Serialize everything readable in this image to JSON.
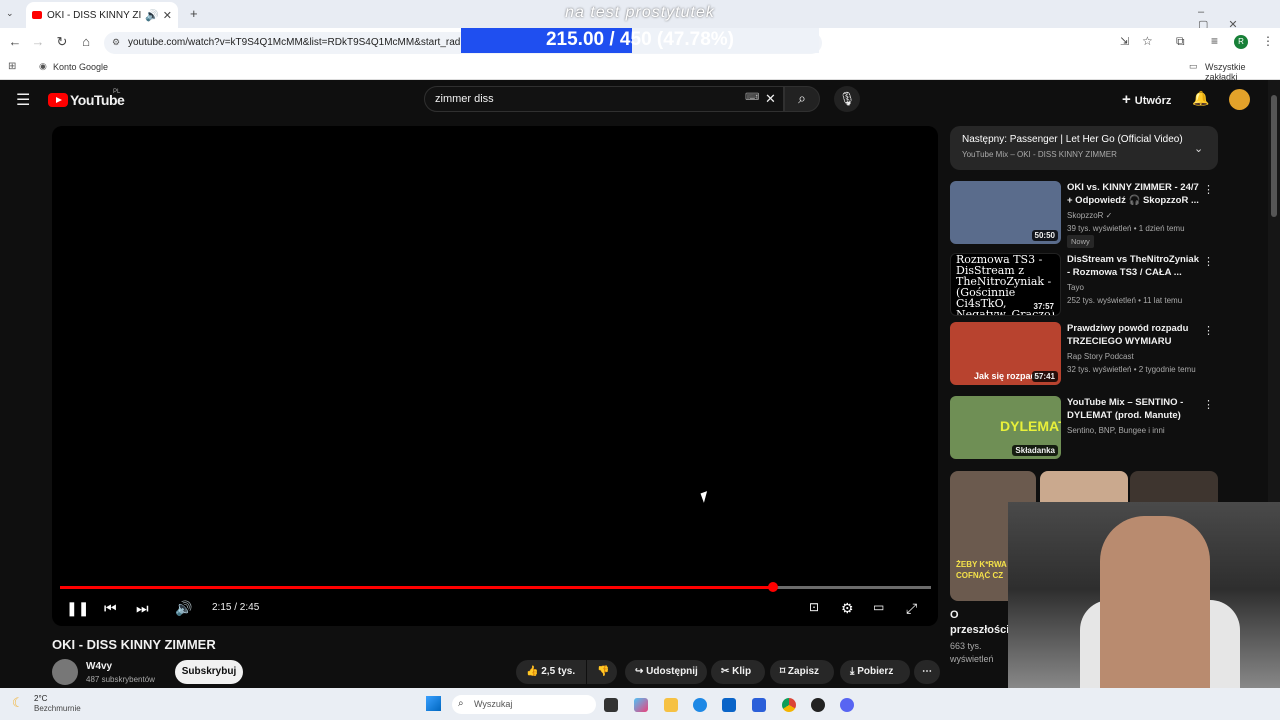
{
  "browser": {
    "tab_title": "OKI - DISS KINNY ZIMMER",
    "url": "youtube.com/watch?v=kT9S4Q1McMM&list=RDkT9S4Q1McMM&start_radio=1",
    "bookmark_google": "Konto Google",
    "bookmark_all": "Wszystkie zakładki",
    "profile_initial": "R"
  },
  "stream_overlay": {
    "text": "na test prostytutek",
    "progress_text": "215.00 / 450 (47.78%)",
    "progress_fraction": 0.4778
  },
  "youtube": {
    "logo": "YouTube",
    "region": "PL",
    "search_value": "zimmer diss",
    "create_label": "Utwórz"
  },
  "player": {
    "time": "2:15 / 2:45",
    "progress_fraction": 0.8182
  },
  "video": {
    "title": "OKI - DISS KINNY ZIMMER",
    "channel": "W4vy",
    "subs": "487 subskrybentów",
    "subscribe": "Subskrybuj",
    "likes": "2,5 tys.",
    "share": "Udostępnij",
    "clip": "Klip",
    "save": "Zapisz",
    "download": "Pobierz"
  },
  "sidebar": {
    "next_label": "Następny: Passenger | Let Her Go (Official Video)",
    "next_sub": "YouTube Mix – OKI - DISS KINNY ZIMMER",
    "items": [
      {
        "title": "OKI vs. KINNY ZIMMER - 24/7 + Odpowiedź 🎧 SkopzzoR ...",
        "channel": "SkopzzoR ✓",
        "meta": "39 tys. wyświetleń • 1 dzień temu",
        "badge": "Nowy",
        "duration": "50:50",
        "thumb_color": "#5a6c8c"
      },
      {
        "title": "DisStream vs TheNitroZyniak - Rozmowa TS3 / CAŁA ...",
        "channel": "Tayo",
        "meta": "252 tys. wyświetleń • 11 lat temu",
        "duration": "37:57",
        "thumb_text": "Rozmowa TS3 - DisStream z TheNitroZyniak - (Gościnnie Ci4sTkO, Negatyw, Graczo)",
        "thumb_color": "#000000"
      },
      {
        "title": "Prawdziwy powód rozpadu TRZECIEGO WYMIARU",
        "channel": "Rap Story Podcast",
        "meta": "32 tys. wyświetleń • 2 tygodnie temu",
        "duration": "57:41",
        "thumb_label": "Jak się rozpadli",
        "thumb_color": "#b8432f"
      },
      {
        "title": "YouTube Mix – SENTINO - DYLEMAT (prod. Manute)",
        "channel": "Sentino, BNP, Bungee i inni",
        "meta": "",
        "duration": "Składanka",
        "thumb_label": "DYLEMAT",
        "thumb_color": "#6f8f55"
      }
    ],
    "short": {
      "title": "O przeszłości.",
      "meta": "663 tys. wyświetleń",
      "caption": "ŻEBY K*RWA COFNĄĆ CZ"
    }
  },
  "taskbar": {
    "temp": "2°C",
    "weather": "Bezchmurnie",
    "search_placeholder": "Wyszukaj"
  }
}
